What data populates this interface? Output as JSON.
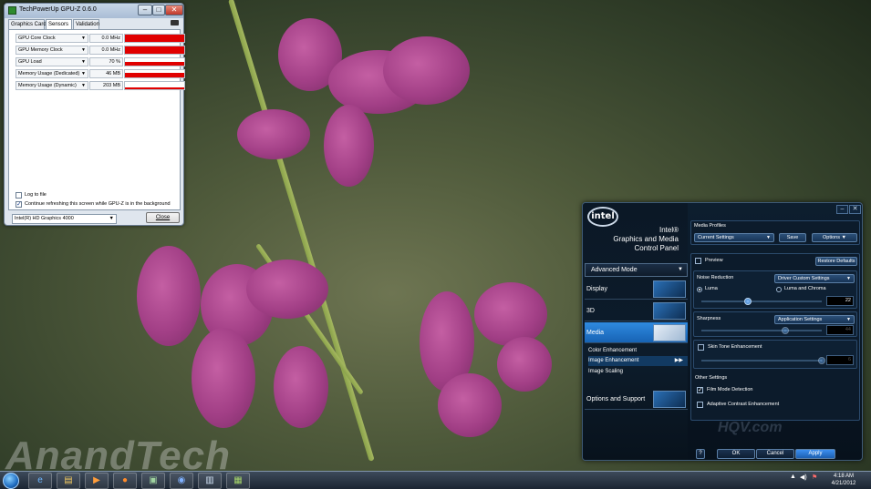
{
  "watermark": "AnandTech",
  "gpuz": {
    "title": "TechPowerUp GPU-Z 0.6.0",
    "tabs": [
      "Graphics Card",
      "Sensors",
      "Validation"
    ],
    "sensors": [
      {
        "name": "GPU Core Clock",
        "value": "0.0 MHz",
        "fill": 1.0
      },
      {
        "name": "GPU Memory Clock",
        "value": "0.0 MHz",
        "fill": 1.0
      },
      {
        "name": "GPU Load",
        "value": "70 %",
        "fill": 0.5
      },
      {
        "name": "Memory Usage (Dedicated)",
        "value": "46 MB",
        "fill": 0.6
      },
      {
        "name": "Memory Usage (Dynamic)",
        "value": "203 MB",
        "fill": 0.2
      }
    ],
    "log_to_file": "Log to file",
    "continue_refresh": "Continue refreshing this screen while GPU-Z is in the background",
    "gpu_select": "Intel(R) HD Graphics 4000",
    "close": "Close"
  },
  "intel": {
    "logo": "intel",
    "brand_line1": "Intel®",
    "brand_line2": "Graphics and Media",
    "brand_line3": "Control Panel",
    "mode": "Advanced Mode",
    "nav": [
      "Display",
      "3D",
      "Media",
      "Options and Support"
    ],
    "subnav": [
      "Color Enhancement",
      "Image Enhancement",
      "Image Scaling"
    ],
    "media_profiles_label": "Media Profiles",
    "profile_value": "Current Settings",
    "save": "Save",
    "options": "Options",
    "preview": "Preview",
    "restore_defaults": "Restore Defaults",
    "noise_reduction": "Noise Reduction",
    "noise_setting": "Driver Custom Settings",
    "luma": "Luma",
    "luma_chroma": "Luma and Chroma",
    "noise_value": "22",
    "sharpness": "Sharpness",
    "sharpness_setting": "Application Settings",
    "sharpness_value": "44",
    "skin_tone": "Skin Tone Enhancement",
    "skin_value": "6",
    "other_settings": "Other Settings",
    "film_mode": "Film Mode Detection",
    "adaptive_contrast": "Adaptive Contrast Enhancement",
    "hqv": "HQV.com",
    "help": "?",
    "ok": "OK",
    "cancel": "Cancel",
    "apply": "Apply"
  },
  "taskbar": {
    "time": "4:18 AM",
    "date": "4/21/2012"
  }
}
